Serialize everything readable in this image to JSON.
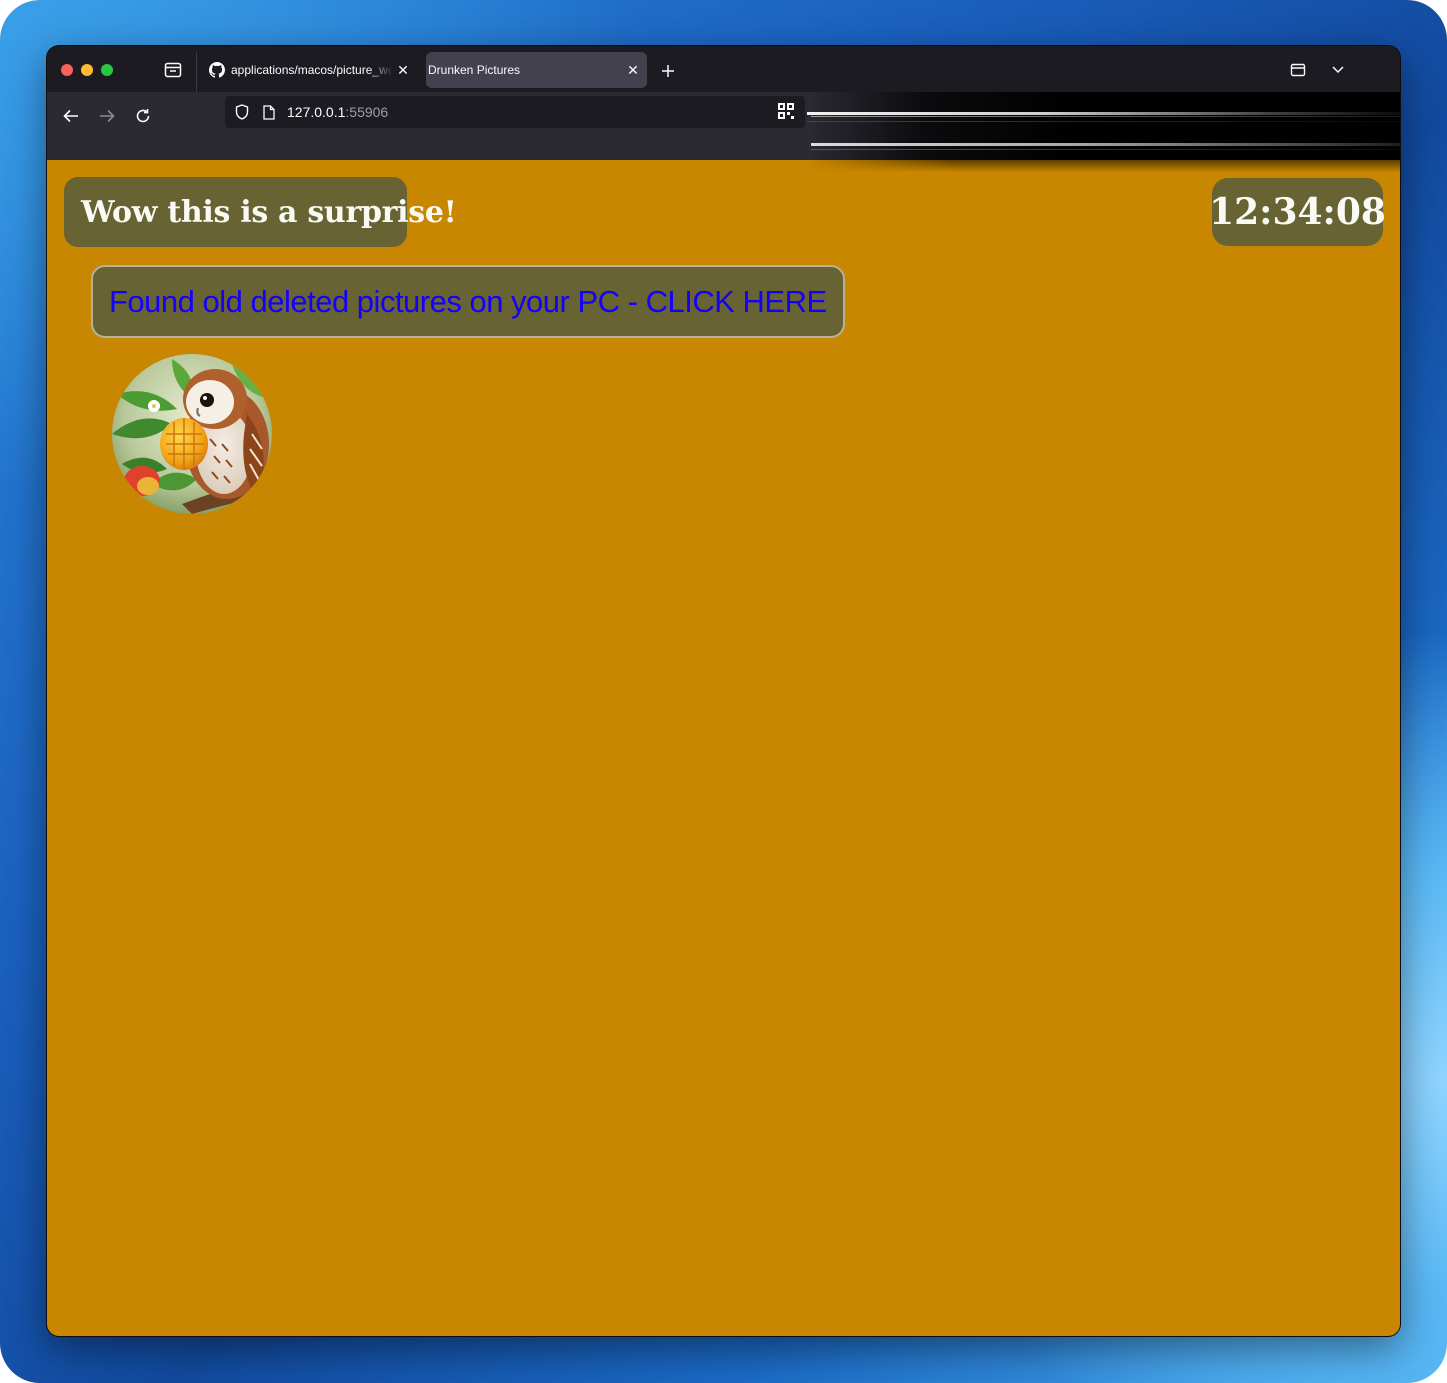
{
  "browser": {
    "tabs": [
      {
        "title": "applications/macos/picture_web",
        "favicon": "github-icon",
        "active": false
      },
      {
        "title": "Drunken Pictures",
        "favicon": "",
        "active": true
      }
    ],
    "url_host": "127.0.0.1",
    "url_port": ":55906"
  },
  "page": {
    "banner_text": "Wow this is a surprise!",
    "clock_text": "12:34:08",
    "cta_text": "Found old deleted pictures on your PC - CLICK HERE",
    "avatar_alt": "owl-with-mango-image",
    "background_color": "#c98600",
    "box_color": "#686333",
    "link_color": "#1400ff"
  }
}
